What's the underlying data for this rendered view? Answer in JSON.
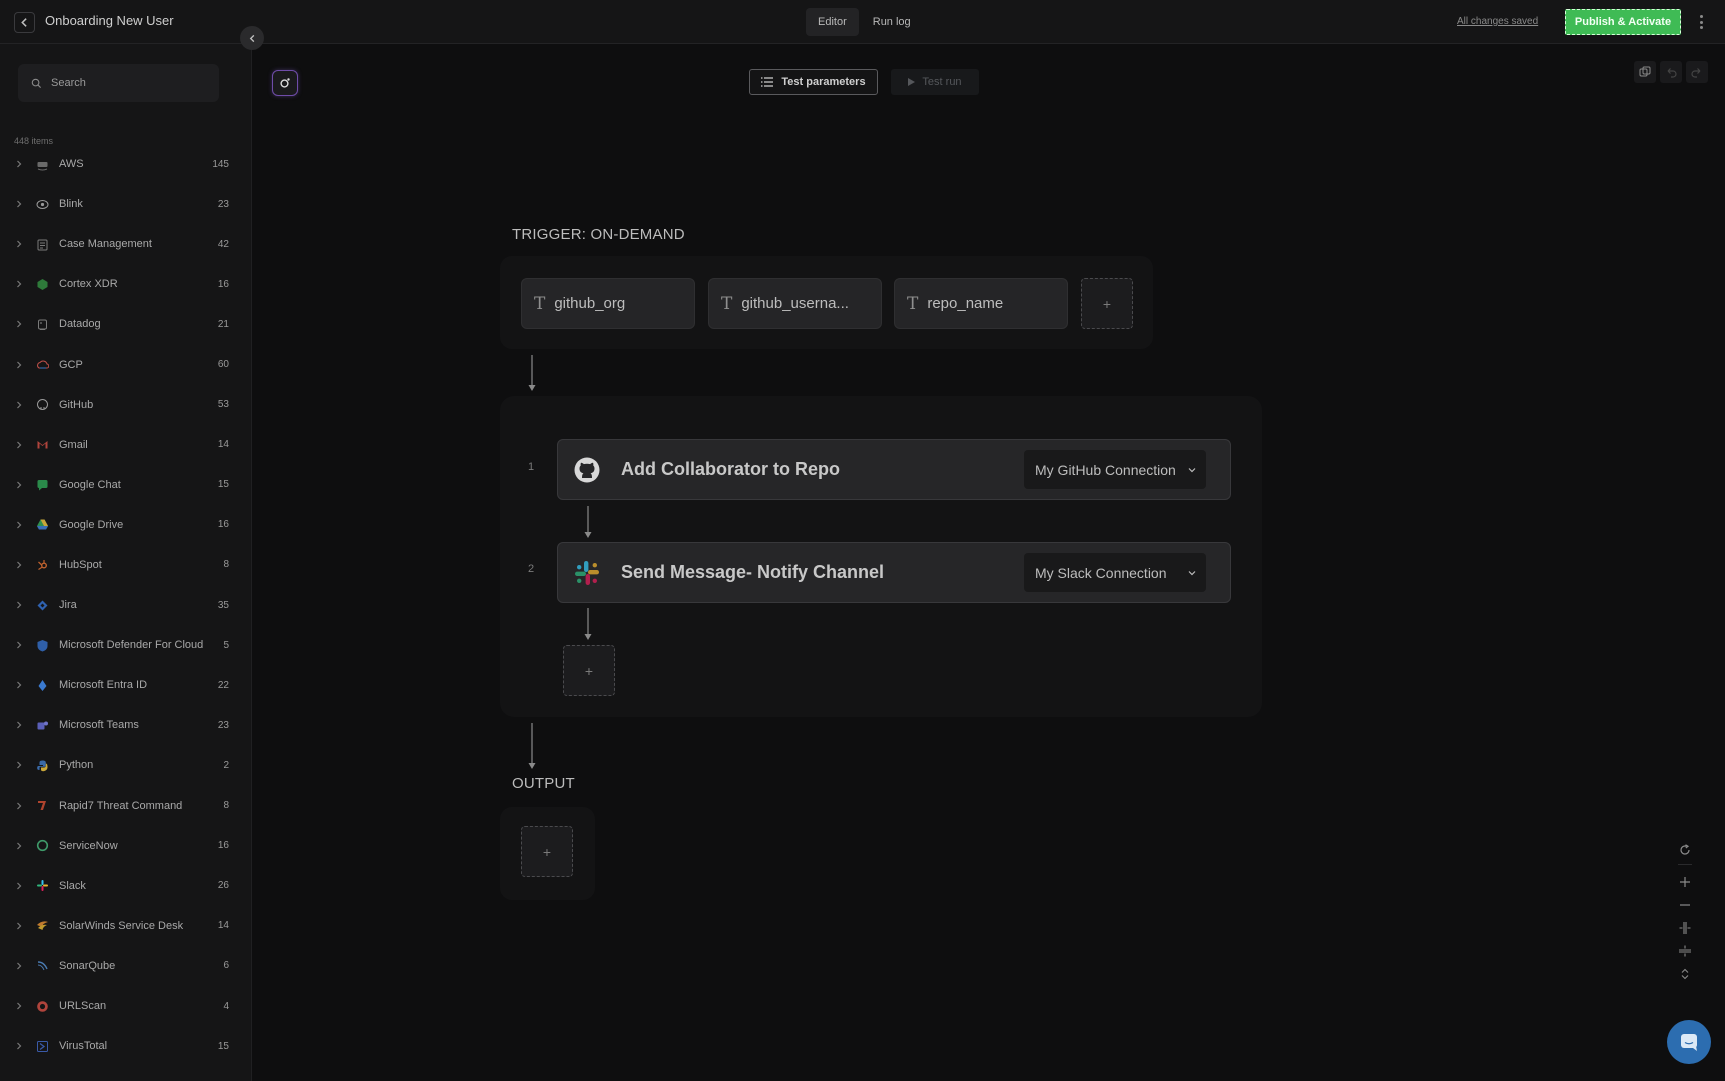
{
  "header": {
    "title": "Onboarding New User",
    "tabs": [
      {
        "label": "Editor",
        "active": true
      },
      {
        "label": "Run log",
        "active": false
      }
    ],
    "saved_status": "All changes saved",
    "publish_label": "Publish & Activate"
  },
  "sidebar": {
    "search_placeholder": "Search",
    "items_count": "448 items",
    "categories": [
      {
        "name": "AWS",
        "count": "145",
        "icon": "aws-icon"
      },
      {
        "name": "Blink",
        "count": "23",
        "icon": "blink-icon"
      },
      {
        "name": "Case Management",
        "count": "42",
        "icon": "case-management-icon"
      },
      {
        "name": "Cortex XDR",
        "count": "16",
        "icon": "cortex-xdr-icon"
      },
      {
        "name": "Datadog",
        "count": "21",
        "icon": "datadog-icon"
      },
      {
        "name": "GCP",
        "count": "60",
        "icon": "gcp-icon"
      },
      {
        "name": "GitHub",
        "count": "53",
        "icon": "github-icon"
      },
      {
        "name": "Gmail",
        "count": "14",
        "icon": "gmail-icon"
      },
      {
        "name": "Google Chat",
        "count": "15",
        "icon": "google-chat-icon"
      },
      {
        "name": "Google Drive",
        "count": "16",
        "icon": "google-drive-icon"
      },
      {
        "name": "HubSpot",
        "count": "8",
        "icon": "hubspot-icon"
      },
      {
        "name": "Jira",
        "count": "35",
        "icon": "jira-icon"
      },
      {
        "name": "Microsoft Defender For Cloud",
        "count": "5",
        "icon": "microsoft-defender-icon"
      },
      {
        "name": "Microsoft Entra ID",
        "count": "22",
        "icon": "microsoft-entra-icon"
      },
      {
        "name": "Microsoft Teams",
        "count": "23",
        "icon": "microsoft-teams-icon"
      },
      {
        "name": "Python",
        "count": "2",
        "icon": "python-icon"
      },
      {
        "name": "Rapid7 Threat Command",
        "count": "8",
        "icon": "rapid7-icon"
      },
      {
        "name": "ServiceNow",
        "count": "16",
        "icon": "servicenow-icon"
      },
      {
        "name": "Slack",
        "count": "26",
        "icon": "slack-icon"
      },
      {
        "name": "SolarWinds Service Desk",
        "count": "14",
        "icon": "solarwinds-icon"
      },
      {
        "name": "SonarQube",
        "count": "6",
        "icon": "sonarqube-icon"
      },
      {
        "name": "URLScan",
        "count": "4",
        "icon": "urlscan-icon"
      },
      {
        "name": "VirusTotal",
        "count": "15",
        "icon": "virustotal-icon"
      }
    ]
  },
  "canvas": {
    "test_parameters_label": "Test parameters",
    "test_run_label": "Test run",
    "trigger_label": "TRIGGER: ON-DEMAND",
    "trigger_params": [
      "github_org",
      "github_userna...",
      "repo_name"
    ],
    "add_symbol": "+",
    "steps": [
      {
        "index": "1",
        "title": "Add Collaborator to Repo",
        "connection": "My GitHub Connection",
        "icon": "github-icon"
      },
      {
        "index": "2",
        "title": "Send Message- Notify Channel",
        "connection": "My Slack Connection",
        "icon": "slack-icon"
      }
    ],
    "output_label": "OUTPUT"
  },
  "colors": {
    "publish_green": "#3fbb55",
    "chat_blue": "#2c6db0",
    "logo_purple": "#6f4ca8"
  }
}
